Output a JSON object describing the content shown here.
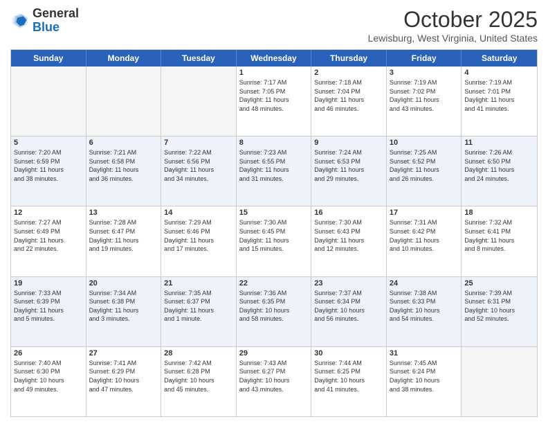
{
  "header": {
    "logo_general": "General",
    "logo_blue": "Blue",
    "month": "October 2025",
    "location": "Lewisburg, West Virginia, United States"
  },
  "days_of_week": [
    "Sunday",
    "Monday",
    "Tuesday",
    "Wednesday",
    "Thursday",
    "Friday",
    "Saturday"
  ],
  "rows": [
    {
      "alt": false,
      "cells": [
        {
          "day": "",
          "text": ""
        },
        {
          "day": "",
          "text": ""
        },
        {
          "day": "",
          "text": ""
        },
        {
          "day": "1",
          "text": "Sunrise: 7:17 AM\nSunset: 7:05 PM\nDaylight: 11 hours\nand 48 minutes."
        },
        {
          "day": "2",
          "text": "Sunrise: 7:18 AM\nSunset: 7:04 PM\nDaylight: 11 hours\nand 46 minutes."
        },
        {
          "day": "3",
          "text": "Sunrise: 7:19 AM\nSunset: 7:02 PM\nDaylight: 11 hours\nand 43 minutes."
        },
        {
          "day": "4",
          "text": "Sunrise: 7:19 AM\nSunset: 7:01 PM\nDaylight: 11 hours\nand 41 minutes."
        }
      ]
    },
    {
      "alt": true,
      "cells": [
        {
          "day": "5",
          "text": "Sunrise: 7:20 AM\nSunset: 6:59 PM\nDaylight: 11 hours\nand 38 minutes."
        },
        {
          "day": "6",
          "text": "Sunrise: 7:21 AM\nSunset: 6:58 PM\nDaylight: 11 hours\nand 36 minutes."
        },
        {
          "day": "7",
          "text": "Sunrise: 7:22 AM\nSunset: 6:56 PM\nDaylight: 11 hours\nand 34 minutes."
        },
        {
          "day": "8",
          "text": "Sunrise: 7:23 AM\nSunset: 6:55 PM\nDaylight: 11 hours\nand 31 minutes."
        },
        {
          "day": "9",
          "text": "Sunrise: 7:24 AM\nSunset: 6:53 PM\nDaylight: 11 hours\nand 29 minutes."
        },
        {
          "day": "10",
          "text": "Sunrise: 7:25 AM\nSunset: 6:52 PM\nDaylight: 11 hours\nand 26 minutes."
        },
        {
          "day": "11",
          "text": "Sunrise: 7:26 AM\nSunset: 6:50 PM\nDaylight: 11 hours\nand 24 minutes."
        }
      ]
    },
    {
      "alt": false,
      "cells": [
        {
          "day": "12",
          "text": "Sunrise: 7:27 AM\nSunset: 6:49 PM\nDaylight: 11 hours\nand 22 minutes."
        },
        {
          "day": "13",
          "text": "Sunrise: 7:28 AM\nSunset: 6:47 PM\nDaylight: 11 hours\nand 19 minutes."
        },
        {
          "day": "14",
          "text": "Sunrise: 7:29 AM\nSunset: 6:46 PM\nDaylight: 11 hours\nand 17 minutes."
        },
        {
          "day": "15",
          "text": "Sunrise: 7:30 AM\nSunset: 6:45 PM\nDaylight: 11 hours\nand 15 minutes."
        },
        {
          "day": "16",
          "text": "Sunrise: 7:30 AM\nSunset: 6:43 PM\nDaylight: 11 hours\nand 12 minutes."
        },
        {
          "day": "17",
          "text": "Sunrise: 7:31 AM\nSunset: 6:42 PM\nDaylight: 11 hours\nand 10 minutes."
        },
        {
          "day": "18",
          "text": "Sunrise: 7:32 AM\nSunset: 6:41 PM\nDaylight: 11 hours\nand 8 minutes."
        }
      ]
    },
    {
      "alt": true,
      "cells": [
        {
          "day": "19",
          "text": "Sunrise: 7:33 AM\nSunset: 6:39 PM\nDaylight: 11 hours\nand 5 minutes."
        },
        {
          "day": "20",
          "text": "Sunrise: 7:34 AM\nSunset: 6:38 PM\nDaylight: 11 hours\nand 3 minutes."
        },
        {
          "day": "21",
          "text": "Sunrise: 7:35 AM\nSunset: 6:37 PM\nDaylight: 11 hours\nand 1 minute."
        },
        {
          "day": "22",
          "text": "Sunrise: 7:36 AM\nSunset: 6:35 PM\nDaylight: 10 hours\nand 58 minutes."
        },
        {
          "day": "23",
          "text": "Sunrise: 7:37 AM\nSunset: 6:34 PM\nDaylight: 10 hours\nand 56 minutes."
        },
        {
          "day": "24",
          "text": "Sunrise: 7:38 AM\nSunset: 6:33 PM\nDaylight: 10 hours\nand 54 minutes."
        },
        {
          "day": "25",
          "text": "Sunrise: 7:39 AM\nSunset: 6:31 PM\nDaylight: 10 hours\nand 52 minutes."
        }
      ]
    },
    {
      "alt": false,
      "cells": [
        {
          "day": "26",
          "text": "Sunrise: 7:40 AM\nSunset: 6:30 PM\nDaylight: 10 hours\nand 49 minutes."
        },
        {
          "day": "27",
          "text": "Sunrise: 7:41 AM\nSunset: 6:29 PM\nDaylight: 10 hours\nand 47 minutes."
        },
        {
          "day": "28",
          "text": "Sunrise: 7:42 AM\nSunset: 6:28 PM\nDaylight: 10 hours\nand 45 minutes."
        },
        {
          "day": "29",
          "text": "Sunrise: 7:43 AM\nSunset: 6:27 PM\nDaylight: 10 hours\nand 43 minutes."
        },
        {
          "day": "30",
          "text": "Sunrise: 7:44 AM\nSunset: 6:25 PM\nDaylight: 10 hours\nand 41 minutes."
        },
        {
          "day": "31",
          "text": "Sunrise: 7:45 AM\nSunset: 6:24 PM\nDaylight: 10 hours\nand 38 minutes."
        },
        {
          "day": "",
          "text": ""
        }
      ]
    }
  ]
}
